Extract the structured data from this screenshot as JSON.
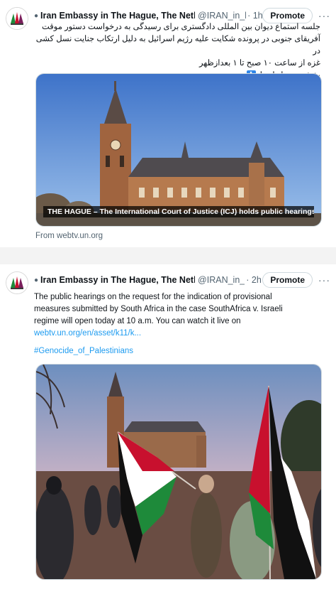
{
  "tweets": [
    {
      "account_name": "Iran Embassy in The Hague, The Nethe",
      "handle": "@IRAN_in_l",
      "time": "· 1h",
      "promote_label": "Promote",
      "more_label": "···",
      "text_lines": [
        "جلسه استماع دیوان بین المللی دادگستری برای رسیدگی  به درخواست دستور موقت",
        "آفریقای جنوبی در پرونده شکایت علیه رژیم اسرائیل به دلیل ارتکاب جنایت نسل کشی در",
        "غزه از ساعت ۱۰ صبح تا ۱ بعدازظهر",
        "پخش زنده از اینجا"
      ],
      "live_badge": "⬇",
      "image_caption": "THE HAGUE – The International Court of Justice (ICJ) holds public hearings in t...",
      "from_text": "From webtv.un.org"
    },
    {
      "account_name": "Iran Embassy in The Hague, The Nethe",
      "handle": "@IRAN_in_",
      "time": "· 2h",
      "promote_label": "Promote",
      "more_label": "···",
      "text_lines": [
        "The public hearings on the request for the indication of provisional",
        "measures submitted by South Africa in the case SouthAfrica v. Israeli",
        "regime will open today at 10 a.m. You can watch it live on"
      ],
      "link": "webtv.un.org/en/asset/k11/k...",
      "hashtag": "#Genocide_of_Palestinians"
    }
  ],
  "colors": {
    "link": "#1d9bf0",
    "muted": "#536471",
    "sky1": "#5f8fd6",
    "sky2": "#f2b8a2",
    "flag_red": "#c8102e",
    "flag_green": "#1e8a3a"
  }
}
